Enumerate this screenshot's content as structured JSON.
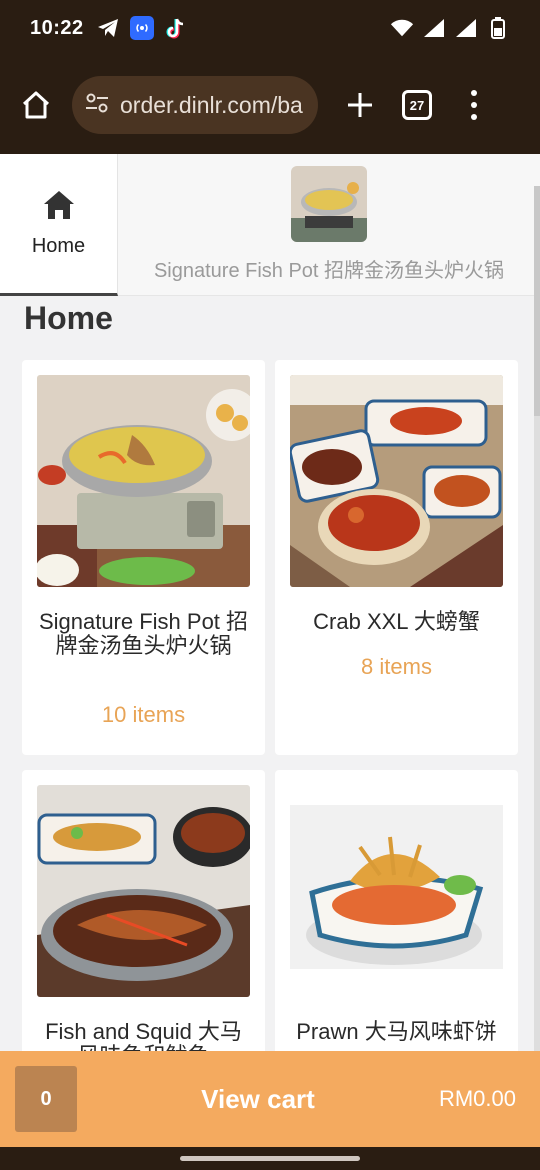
{
  "status_bar": {
    "time": "10:22",
    "left_icons": [
      "telegram-icon",
      "radio-broadcast-icon",
      "tiktok-icon"
    ],
    "right_icons": [
      "wifi-icon",
      "signal-icon",
      "signal-icon",
      "battery-icon"
    ]
  },
  "browser": {
    "url": "order.dinlr.com/ba",
    "tab_count": "27"
  },
  "category_tabs": [
    {
      "label": "Home",
      "icon": "home-icon",
      "active": true
    },
    {
      "label": "Signature Fish Pot 招牌金汤鱼头炉火锅",
      "active": false
    }
  ],
  "section_title": "Home",
  "products": [
    {
      "name": "Signature Fish Pot 招牌金汤鱼头炉火锅",
      "count": "10 items"
    },
    {
      "name": "Crab XXL 大螃蟹",
      "count": "8 items"
    },
    {
      "name": "Fish and Squid 大马风味鱼和鱿鱼",
      "count": ""
    },
    {
      "name": "Prawn 大马风味虾饼",
      "count": ""
    }
  ],
  "cart": {
    "count": "0",
    "label": "View cart",
    "total": "RM0.00"
  },
  "colors": {
    "accent": "#f4aa5f",
    "cart_count_bg": "#bb8451",
    "item_count": "#e8a456",
    "browser_chrome": "#2a1d12"
  }
}
